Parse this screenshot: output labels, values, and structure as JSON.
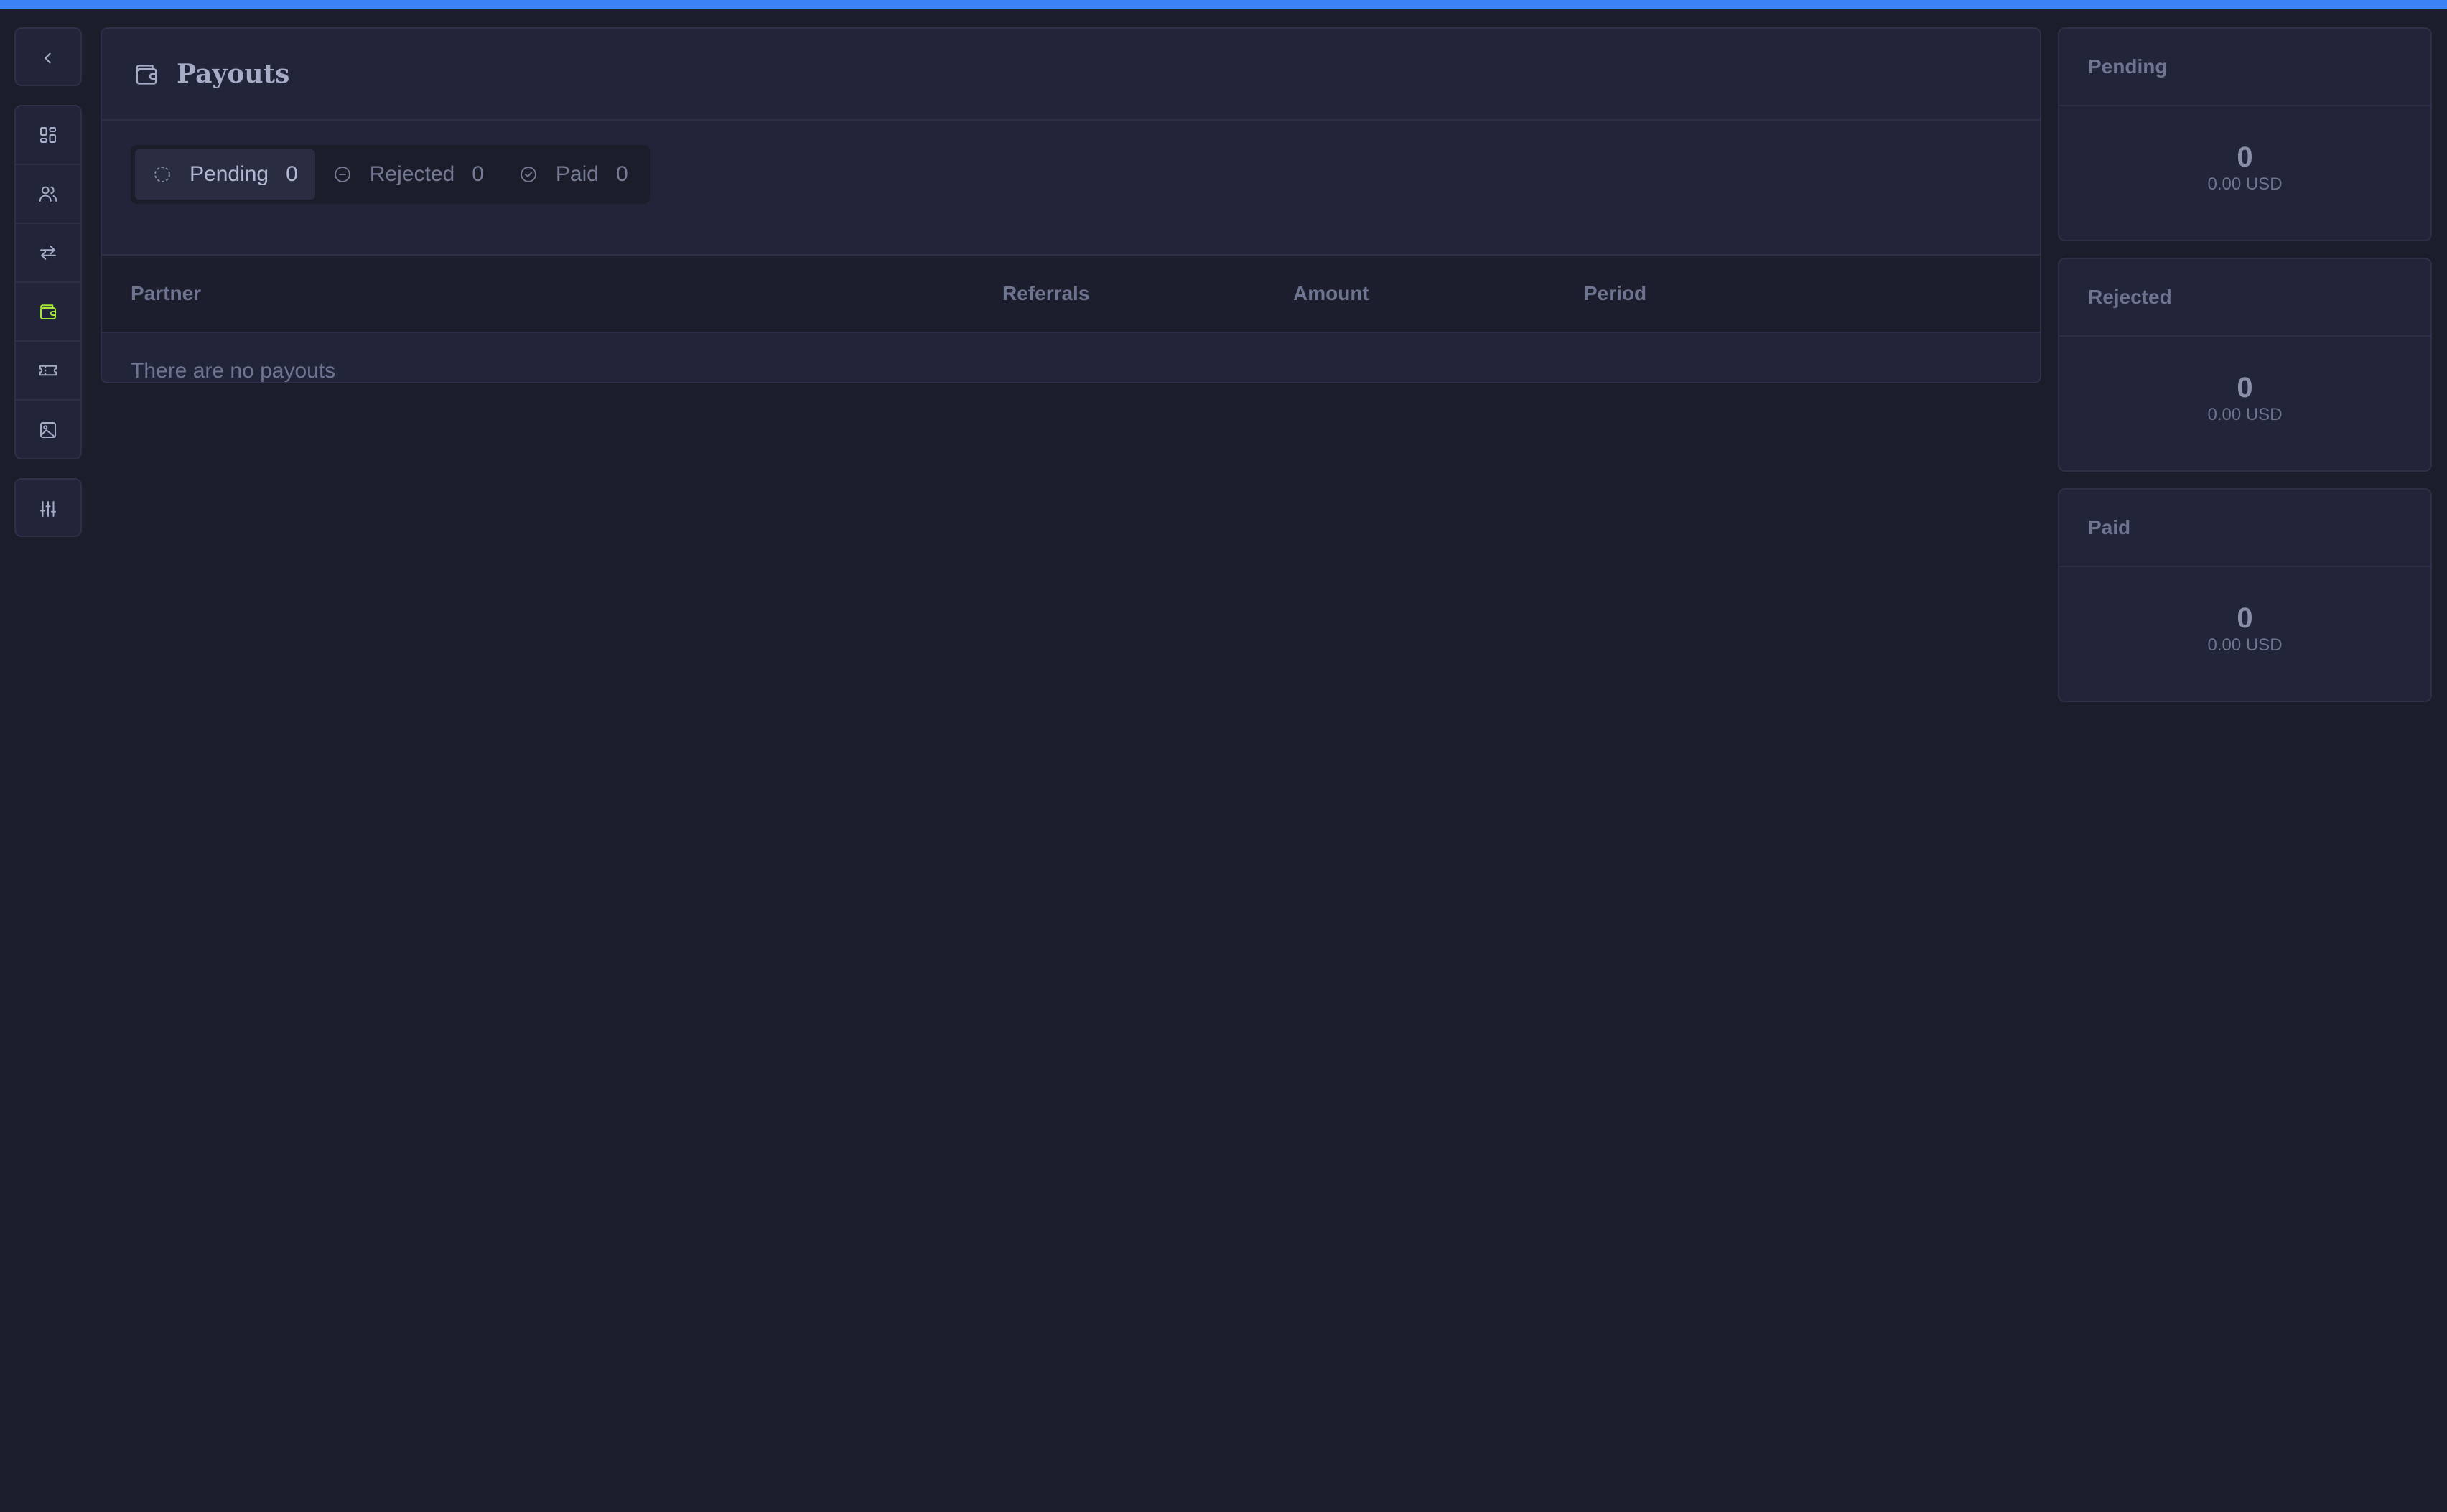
{
  "colors": {
    "topbar": "#3b82f6",
    "background": "#1b1d2b",
    "panel": "#22253a",
    "active_icon": "#a3e635"
  },
  "sidebar": {
    "collapse_icon": "chevron-left-icon",
    "items": [
      {
        "name": "dashboard",
        "icon": "grid-icon"
      },
      {
        "name": "partners",
        "icon": "users-icon"
      },
      {
        "name": "referrals",
        "icon": "arrows-exchange-icon"
      },
      {
        "name": "payouts",
        "icon": "wallet-icon",
        "active": true
      },
      {
        "name": "coupons",
        "icon": "ticket-icon"
      },
      {
        "name": "assets",
        "icon": "image-icon"
      }
    ],
    "settings_icon": "sliders-icon"
  },
  "main": {
    "title": "Payouts",
    "title_icon": "wallet-icon",
    "filters": [
      {
        "label": "Pending",
        "count": "0",
        "icon": "dashed-circle-icon",
        "selected": true
      },
      {
        "label": "Rejected",
        "count": "0",
        "icon": "minus-circle-icon",
        "selected": false
      },
      {
        "label": "Paid",
        "count": "0",
        "icon": "check-circle-icon",
        "selected": false
      }
    ],
    "table": {
      "columns": [
        "Partner",
        "Referrals",
        "Amount",
        "Period"
      ],
      "empty_message": "There are no payouts"
    }
  },
  "stats": [
    {
      "title": "Pending",
      "value": "0",
      "sub": "0.00 USD"
    },
    {
      "title": "Rejected",
      "value": "0",
      "sub": "0.00 USD"
    },
    {
      "title": "Paid",
      "value": "0",
      "sub": "0.00 USD"
    }
  ]
}
